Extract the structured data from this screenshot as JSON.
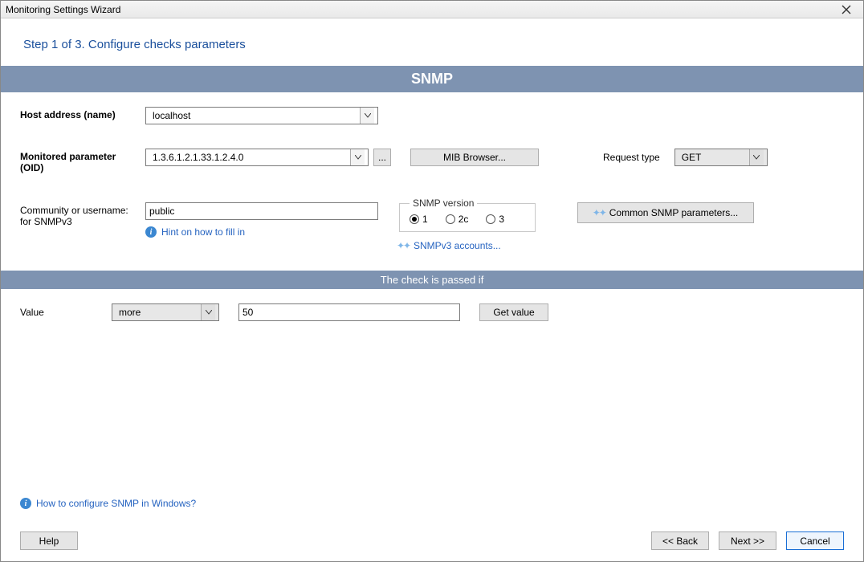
{
  "window": {
    "title": "Monitoring Settings Wizard"
  },
  "step": {
    "header": "Step 1 of 3. Configure checks parameters"
  },
  "sections": {
    "snmp_title": "SNMP",
    "condition_title": "The check is passed if"
  },
  "labels": {
    "host_address": "Host address (name)",
    "monitored_parameter1": "Monitored parameter",
    "monitored_parameter2": "(OID)",
    "community1": "Community or username:",
    "community2": "for SNMPv3",
    "request_type": "Request type",
    "snmp_version": "SNMP version",
    "value": "Value"
  },
  "fields": {
    "host_address": "localhost",
    "oid": "1.3.6.1.2.1.33.1.2.4.0",
    "community": "public",
    "request_type": "GET",
    "value_compare": "more",
    "value_number": "50"
  },
  "radio": {
    "opt1": "1",
    "opt2c": "2c",
    "opt3": "3",
    "selected": "1"
  },
  "buttons": {
    "mib_browser": "MIB Browser...",
    "common_snmp": "Common SNMP parameters...",
    "ellipsis": "...",
    "get_value": "Get value",
    "help": "Help",
    "back": "<< Back",
    "next": "Next >>",
    "cancel": "Cancel"
  },
  "links": {
    "hint_fill": "Hint on how to fill in",
    "snmpv3_accounts": "SNMPv3 accounts...",
    "howto_windows": "How to configure SNMP in Windows?"
  }
}
